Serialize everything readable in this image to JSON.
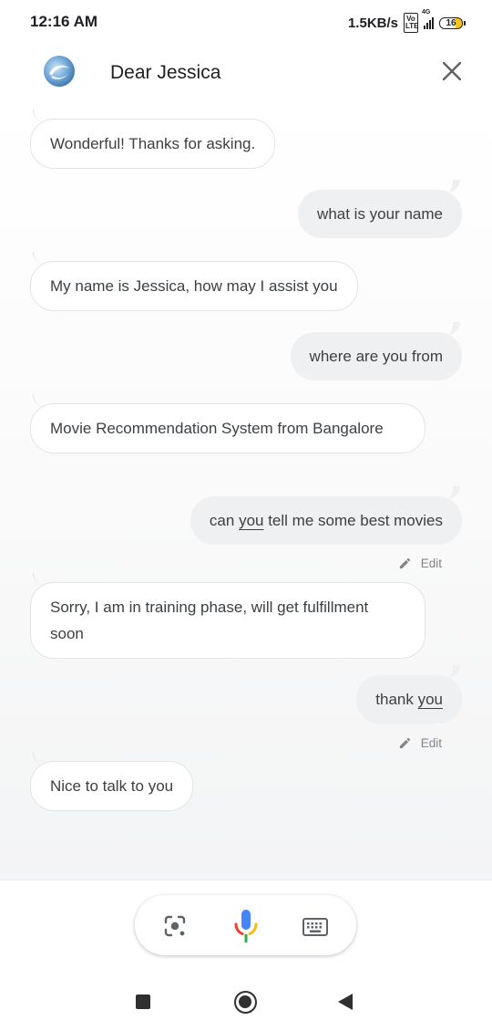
{
  "status_bar": {
    "time": "12:16 AM",
    "net_speed": "1.5KB/s",
    "volte": "Vo LTE",
    "network": "4G",
    "battery": "16"
  },
  "header": {
    "title": "Dear Jessica",
    "logo_icon": "app-logo-icon",
    "close_icon": "close-icon"
  },
  "messages": [
    {
      "sender": "bot",
      "parts": [
        "Wonderful! Thanks for asking."
      ]
    },
    {
      "sender": "user",
      "parts": [
        "what is your name"
      ]
    },
    {
      "sender": "bot",
      "parts": [
        "My name is Jessica, how may I assist you"
      ]
    },
    {
      "sender": "user",
      "parts": [
        "where are you from"
      ]
    },
    {
      "sender": "bot",
      "parts": [
        "Movie Recommendation System from Bangalore"
      ]
    },
    {
      "sender": "user",
      "parts": [
        "can ",
        "you",
        " tell me some best movies"
      ],
      "edit_label": "Edit"
    },
    {
      "sender": "bot",
      "parts": [
        "Sorry, I am in training phase, will get fulfillment soon"
      ]
    },
    {
      "sender": "user",
      "parts": [
        "thank ",
        "you"
      ],
      "edit_label": "Edit"
    },
    {
      "sender": "bot",
      "parts": [
        "Nice to talk to you"
      ]
    }
  ],
  "input_bar": {
    "lens_icon": "lens-icon",
    "mic_icon": "mic-icon",
    "keyboard_icon": "keyboard-icon"
  },
  "nav_bar": {
    "recents_icon": "recents-icon",
    "home_icon": "home-icon",
    "back_icon": "back-icon"
  },
  "colors": {
    "user_bubble": "#eff0f2",
    "bot_bubble_border": "#e3e4e6",
    "text": "#3c4043",
    "mic_blue": "#4285f4",
    "mic_red": "#ea4335",
    "mic_yellow": "#fbbc05",
    "mic_green": "#34a853"
  }
}
